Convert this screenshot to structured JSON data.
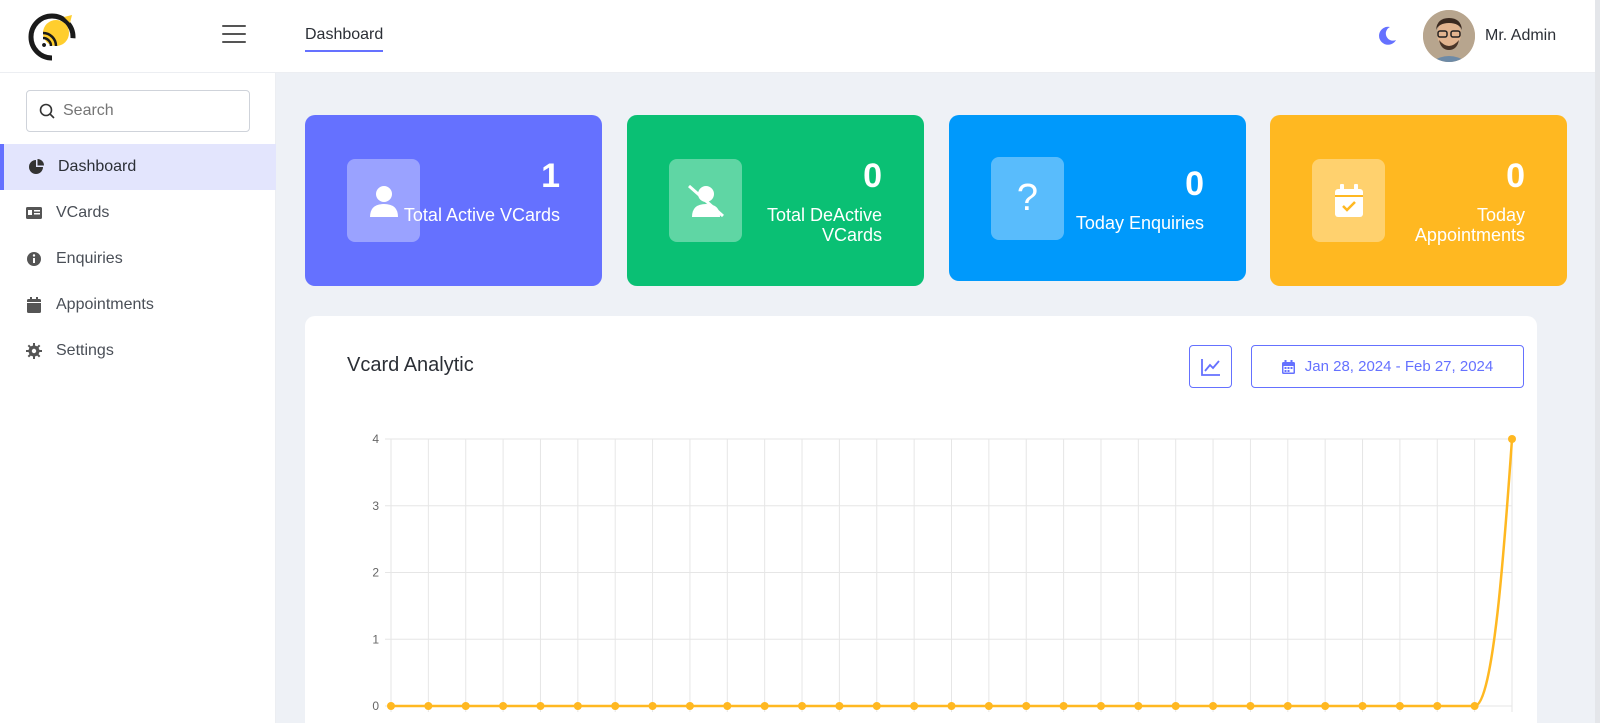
{
  "header": {
    "tab_label": "Dashboard",
    "user_name": "Mr. Admin"
  },
  "sidebar": {
    "search_placeholder": "Search",
    "items": [
      {
        "label": "Dashboard",
        "icon": "pie-chart-icon",
        "active": true
      },
      {
        "label": "VCards",
        "icon": "id-card-icon",
        "active": false
      },
      {
        "label": "Enquiries",
        "icon": "info-circle-icon",
        "active": false
      },
      {
        "label": "Appointments",
        "icon": "calendar-icon",
        "active": false
      },
      {
        "label": "Settings",
        "icon": "gear-icon",
        "active": false
      }
    ]
  },
  "cards": [
    {
      "value": "1",
      "label": "Total Active VCards",
      "color": "#6571ff",
      "icon": "user-icon"
    },
    {
      "value": "0",
      "label": "Total DeActive VCards",
      "color": "#0ac074",
      "icon": "user-slash-icon"
    },
    {
      "value": "0",
      "label": "Today Enquiries",
      "color": "#0099fb",
      "icon": "question-icon"
    },
    {
      "value": "0",
      "label": "Today Appointments",
      "color": "#ffb821",
      "icon": "calendar-check-icon"
    }
  ],
  "analytics": {
    "title": "Vcard Analytic",
    "date_range": "Jan 28, 2024 - Feb 27, 2024",
    "chart_icon": "line-chart-icon",
    "date_icon": "calendar-icon"
  },
  "chart_data": {
    "type": "line",
    "ylim": [
      0,
      4
    ],
    "yticks": [
      0,
      1,
      2,
      3,
      4
    ],
    "grid": true,
    "line_color": "#ffb821",
    "series": [
      {
        "values": [
          0,
          0,
          0,
          0,
          0,
          0,
          0,
          0,
          0,
          0,
          0,
          0,
          0,
          0,
          0,
          0,
          0,
          0,
          0,
          0,
          0,
          0,
          0,
          0,
          0,
          0,
          0,
          0,
          0,
          0,
          4
        ]
      }
    ]
  }
}
